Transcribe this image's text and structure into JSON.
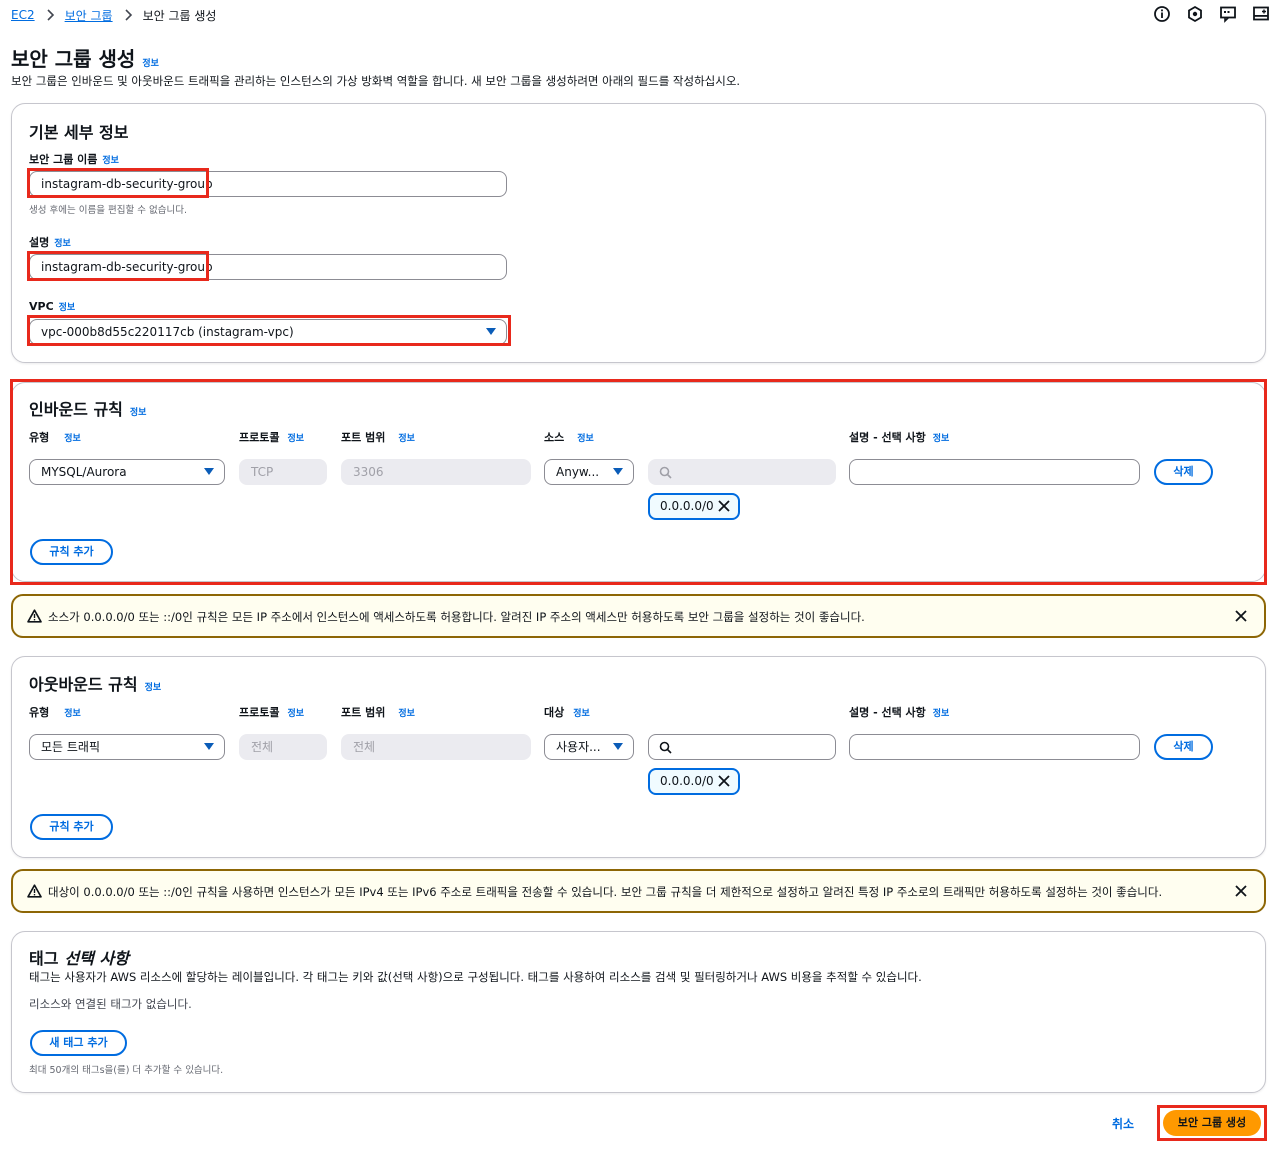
{
  "breadcrumb": {
    "root": "EC2",
    "parent": "보안 그룹",
    "current": "보안 그룹 생성"
  },
  "page": {
    "title": "보안 그룹 생성",
    "info": "정보",
    "description": "보안 그룹은 인바운드 및 아웃바운드 트래픽을 관리하는 인스턴스의 가상 방화벽 역할을 합니다. 새 보안 그룹을 생성하려면 아래의 필드를 작성하십시오."
  },
  "basic": {
    "heading": "기본 세부 정보",
    "name_label": "보안 그룹 이름",
    "name_value": "instagram-db-security-group",
    "name_hint": "생성 후에는 이름을 편집할 수 없습니다.",
    "desc_label": "설명",
    "desc_value": "instagram-db-security-group",
    "vpc_label": "VPC",
    "vpc_value": "vpc-000b8d55c220117cb (instagram-vpc)"
  },
  "inbound": {
    "heading": "인바운드 규칙",
    "col_type": "유형",
    "col_protocol": "프로토콜",
    "col_port": "포트 범위",
    "col_source": "소스",
    "col_desc": "설명 - 선택 사항",
    "type_value": "MYSQL/Aurora",
    "protocol_value": "TCP",
    "port_value": "3306",
    "source_value": "Anyw...",
    "token": "0.0.0.0/0",
    "delete_label": "삭제",
    "add_rule": "규칙 추가"
  },
  "inbound_alert": "소스가 0.0.0.0/0 또는 ::/0인 규칙은 모든 IP 주소에서 인스턴스에 액세스하도록 허용합니다. 알려진 IP 주소의 액세스만 허용하도록 보안 그룹을 설정하는 것이 좋습니다.",
  "outbound": {
    "heading": "아웃바운드 규칙",
    "col_type": "유형",
    "col_protocol": "프로토콜",
    "col_port": "포트 범위",
    "col_dest": "대상",
    "col_desc": "설명 - 선택 사항",
    "type_value": "모든 트래픽",
    "protocol_value": "전체",
    "port_value": "전체",
    "dest_value": "사용자...",
    "token": "0.0.0.0/0",
    "delete_label": "삭제",
    "add_rule": "규칙 추가"
  },
  "outbound_alert": "대상이 0.0.0.0/0 또는 ::/0인 규칙을 사용하면 인스턴스가 모든 IPv4 또는 IPv6 주소로 트래픽을 전송할 수 있습니다. 보안 그룹 규칙을 더 제한적으로 설정하고 알려진 특정 IP 주소로의 트래픽만 허용하도록 설정하는 것이 좋습니다.",
  "tags": {
    "heading": "태그",
    "heading_optional": "선택 사항",
    "description": "태그는 사용자가 AWS 리소스에 할당하는 레이블입니다. 각 태그는 키와 값(선택 사항)으로 구성됩니다. 태그를 사용하여 리소스를 검색 및 필터링하거나 AWS 비용을 추적할 수 있습니다.",
    "empty": "리소스와 연결된 태그가 없습니다.",
    "add_tag": "새 태그 추가",
    "limit": "최대 50개의 태그s을(를) 더 추가할 수 있습니다."
  },
  "footer": {
    "cancel": "취소",
    "submit": "보안 그룹 생성"
  },
  "colors": {
    "accent": "#006ce0",
    "primary_button": "#ff9900",
    "highlight": "#e8291c",
    "warning_border": "#8d6605"
  },
  "icons": [
    "info-circle-icon",
    "notifications-icon",
    "feedback-icon",
    "split-panel-icon",
    "warning-icon",
    "close-icon",
    "search-icon",
    "caret-down-icon"
  ]
}
